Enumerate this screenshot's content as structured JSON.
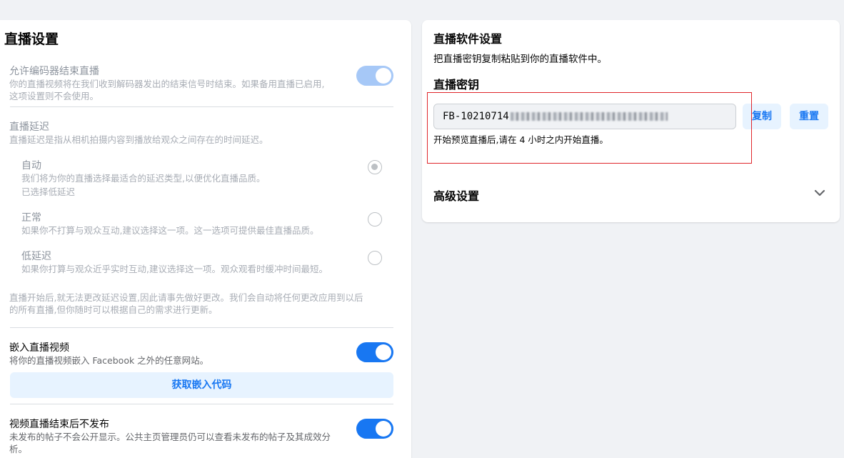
{
  "live_settings": {
    "title": "直播设置",
    "encoder_end": {
      "label": "允许编码器结束直播",
      "desc_line1": "你的直播视频将在我们收到解码器发出的结束信号时结束。如果备用直播已启用,",
      "desc_line2": "这项设置则不会使用。",
      "enabled": true
    },
    "latency": {
      "label": "直播延迟",
      "desc": "直播延迟是指从相机拍摄内容到播放给观众之间存在的时间延迟。",
      "options": [
        {
          "label": "自动",
          "desc": "我们将为你的直播选择最适合的延迟类型,以便优化直播品质。",
          "note": "已选择低延迟",
          "selected": true
        },
        {
          "label": "正常",
          "desc": "如果你不打算与观众互动,建议选择这一项。这一选项可提供最佳直播品质。",
          "selected": false
        },
        {
          "label": "低延迟",
          "desc": "如果你打算与观众近乎实时互动,建议选择这一项。观众观看时缓冲时间最短。",
          "selected": false
        }
      ],
      "footnote_line1": "直播开始后,就无法更改延迟设置,因此请事先做好更改。我们会自动将任何更改应用到以后",
      "footnote_line2": "的所有直播,但你随时可以根据自己的需求进行更新。"
    },
    "embed": {
      "label": "嵌入直播视频",
      "desc": "将你的直播视频嵌入 Facebook 之外的任意网站。",
      "enabled": true,
      "button_label": "获取嵌入代码"
    },
    "unpublish": {
      "label": "视频直播结束后不发布",
      "desc_line1": "未发布的帖子不会公开显示。公共主页管理员仍可以查看未发布的帖子及其成效分",
      "desc_line2": "析。",
      "enabled": true
    }
  },
  "software_settings": {
    "title": "直播软件设置",
    "desc": "把直播密钥复制粘贴到你的直播软件中。",
    "stream_key": {
      "label": "直播密钥",
      "value_prefix": "FB-10210714",
      "copy_label": "复制",
      "reset_label": "重置",
      "note": "开始预览直播后,请在 4 小时之内开始直播。"
    },
    "advanced": {
      "label": "高级设置"
    }
  },
  "colors": {
    "accent": "#1877f2",
    "highlight_box": "#e0262b"
  }
}
